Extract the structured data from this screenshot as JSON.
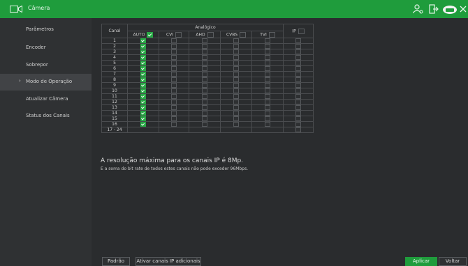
{
  "window": {
    "title": "Câmera"
  },
  "sidebar": {
    "items": [
      {
        "label": "Parâmetros",
        "active": false
      },
      {
        "label": "Encoder",
        "active": false
      },
      {
        "label": "Sobrepor",
        "active": false
      },
      {
        "label": "Modo de Operação",
        "active": true
      },
      {
        "label": "Atualizar Câmera",
        "active": false
      },
      {
        "label": "Status dos Canais",
        "active": false
      }
    ]
  },
  "table": {
    "canal_header": "Canal",
    "analog_header": "Analógico",
    "ip_header": "IP",
    "columns": [
      "AUTO",
      "CVI",
      "AHD",
      "CVBS",
      "TVI"
    ],
    "header_checked": [
      true,
      false,
      false,
      false,
      false
    ],
    "ip_header_checked": false,
    "rows": [
      "1",
      "2",
      "3",
      "4",
      "5",
      "6",
      "7",
      "8",
      "9",
      "10",
      "11",
      "12",
      "13",
      "14",
      "15",
      "16"
    ],
    "auto_checked": true,
    "ip_row_label": "17 - 24"
  },
  "notes": {
    "max_resolution": "A resolução máxima para os canais IP é 8Mp.",
    "bitrate": "E a soma do bit rate de todos estes canais não pode exceder 96Mbps."
  },
  "buttons": {
    "default": "Padrão",
    "add_ip": "Ativar canais IP adicionais",
    "apply": "Aplicar",
    "back": "Voltar"
  },
  "colors": {
    "accent": "#1f9c3c"
  }
}
